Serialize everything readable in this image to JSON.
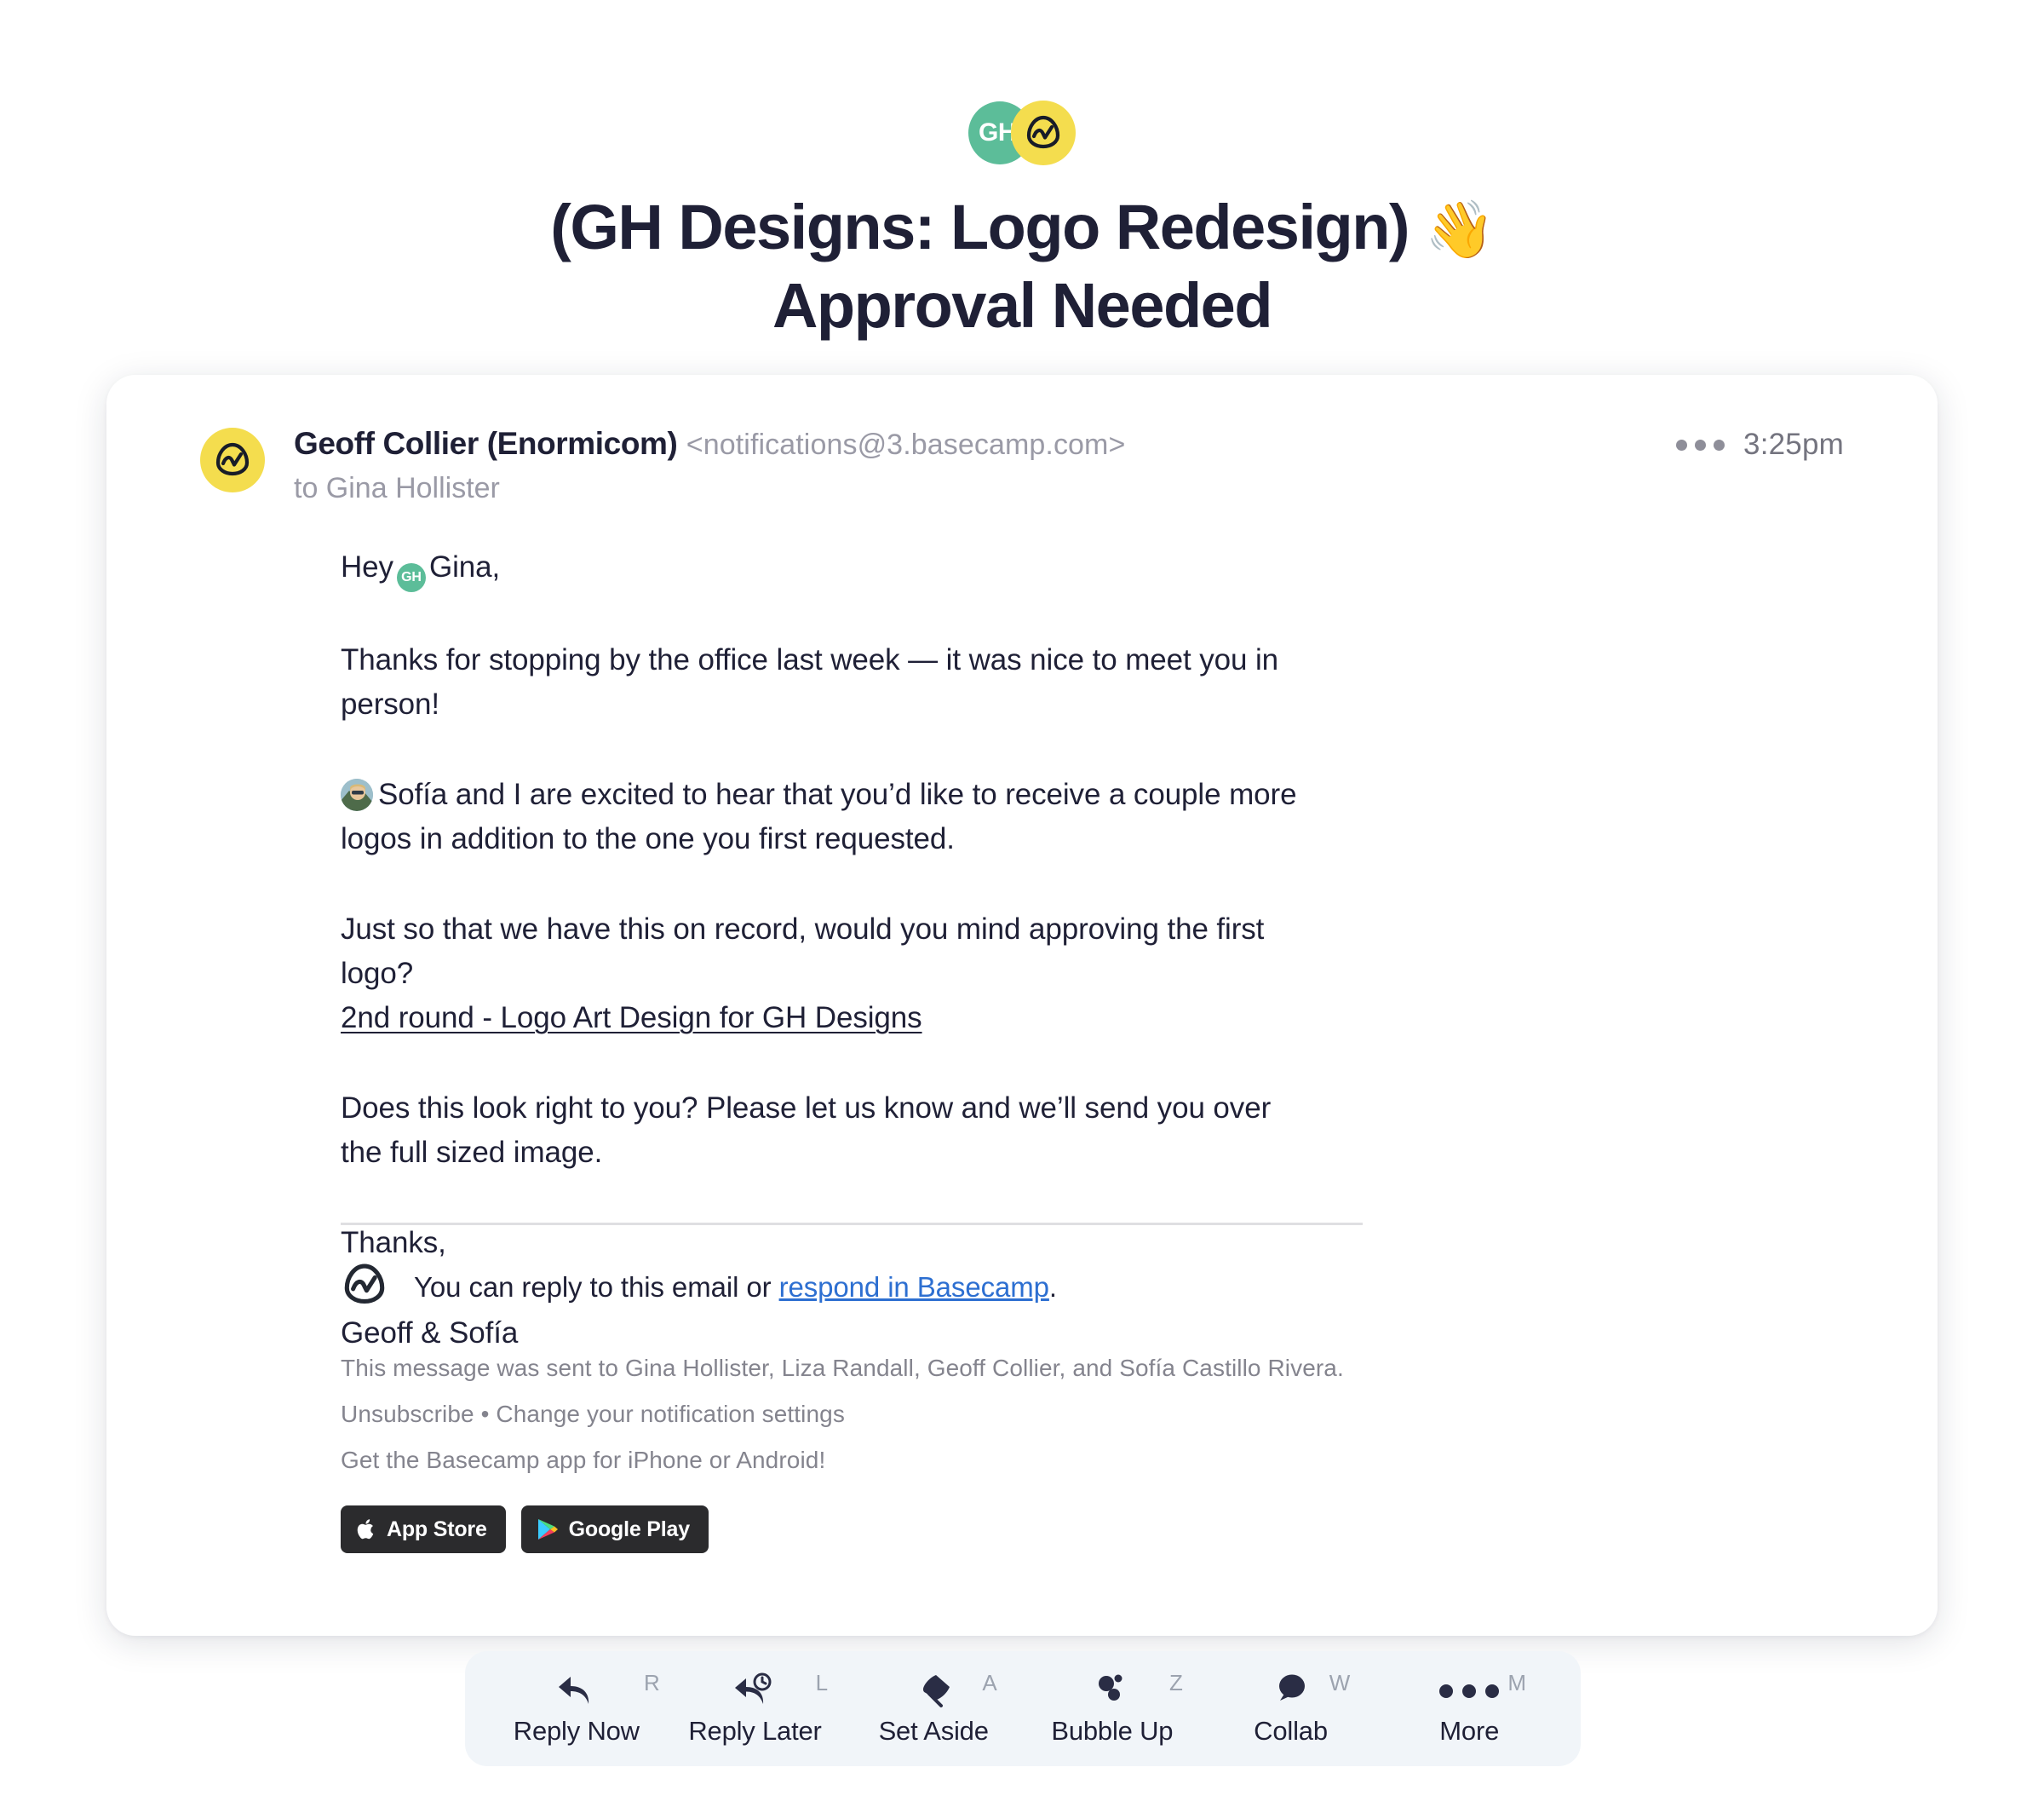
{
  "brand": {
    "gh_initials": "GH",
    "gh_color": "#5CBD99",
    "basecamp_color": "#F4DD4E"
  },
  "header": {
    "title_line1": "(GH Designs: Logo Redesign)",
    "title_emoji": "👋",
    "title_line2": "Approval Needed",
    "title_color": "#1F2036"
  },
  "message": {
    "sender_name": "Geoff Collier (Enormicom)",
    "sender_email": "<notifications@3.basecamp.com>",
    "recipient_line": "to Gina Hollister",
    "timestamp": "3:25pm",
    "more_icon": "ellipsis-icon",
    "avatar_icon": "basecamp-logo-icon"
  },
  "body": {
    "greeting_before": "Hey",
    "greeting_badge": "GH",
    "greeting_after": "Gina,",
    "p1": "Thanks for stopping by the office last week — it was nice to meet you in person!",
    "p2": "Sofía and I are excited to hear that you’d like to receive a couple more logos in addition to the one you first requested.",
    "p3": "Just so that we have this on record, would you mind approving the first logo?",
    "p3_link": "2nd round - Logo Art Design for GH Designs",
    "p4": "Does this look right to you? Please let us know and we’ll send you over the full sized image.",
    "sign_off": "Thanks,",
    "signature": "Geoff & Sofía"
  },
  "footer": {
    "reply_prefix": "You can reply to this email or ",
    "reply_link": "respond in Basecamp",
    "reply_suffix": ".",
    "sent_to": "This message was sent to Gina Hollister, Liza Randall, Geoff Collier, and Sofía Castillo Rivera.",
    "unsubscribe_line": "Unsubscribe • Change your notification settings",
    "app_line": "Get the Basecamp app for iPhone or Android!",
    "link_color": "#2D6FD1",
    "badges": [
      {
        "label": "App Store",
        "icon": "apple-icon"
      },
      {
        "label": "Google Play",
        "icon": "google-play-icon"
      }
    ]
  },
  "toolbar": {
    "background": "#F1F5F9",
    "items": [
      {
        "label": "Reply Now",
        "key": "R",
        "icon": "reply-arrow-icon"
      },
      {
        "label": "Reply Later",
        "key": "L",
        "icon": "reply-clock-icon"
      },
      {
        "label": "Set Aside",
        "key": "A",
        "icon": "pin-icon"
      },
      {
        "label": "Bubble Up",
        "key": "Z",
        "icon": "bubbles-icon"
      },
      {
        "label": "Collab",
        "key": "W",
        "icon": "speech-bubble-icon"
      },
      {
        "label": "More",
        "key": "M",
        "icon": "ellipsis-icon"
      }
    ]
  }
}
